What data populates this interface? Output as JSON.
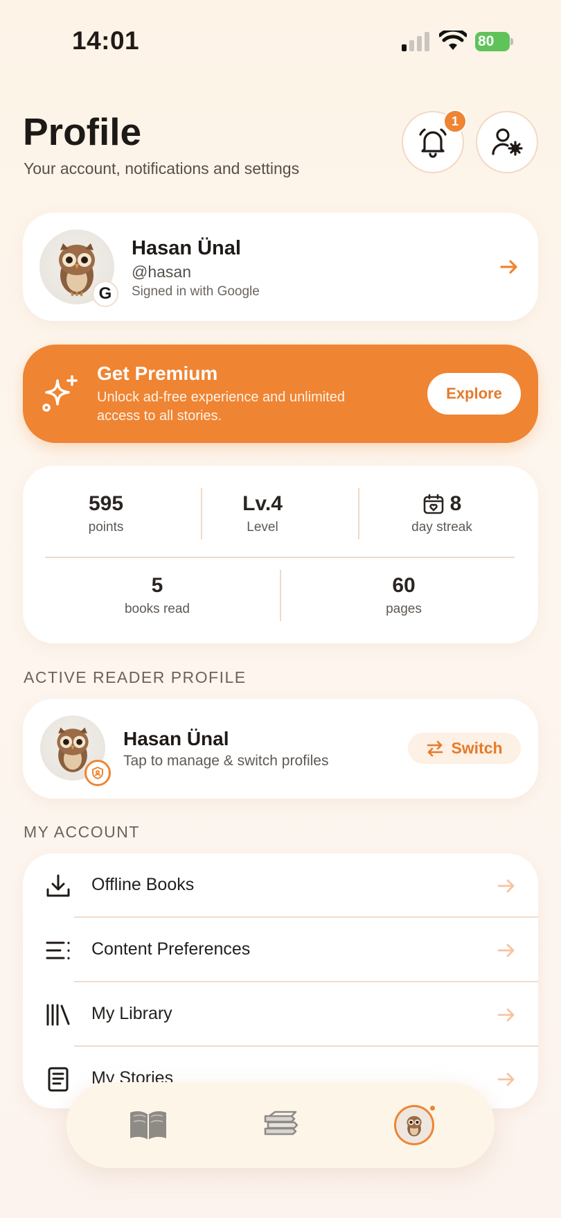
{
  "status_bar": {
    "time": "14:01",
    "battery": "80"
  },
  "header": {
    "title": "Profile",
    "subtitle": "Your account, notifications and settings",
    "notification_count": "1"
  },
  "user": {
    "name": "Hasan Ünal",
    "handle": "@hasan",
    "signin_method": "Signed in with Google",
    "provider_badge": "G"
  },
  "premium": {
    "title": "Get Premium",
    "description": "Unlock ad-free experience and unlimited access to all stories.",
    "button": "Explore"
  },
  "stats": {
    "points_value": "595",
    "points_label": "points",
    "level_value": "Lv.4",
    "level_label": "Level",
    "streak_value": "8",
    "streak_label": "day streak",
    "books_value": "5",
    "books_label": "books read",
    "pages_value": "60",
    "pages_label": "pages"
  },
  "reader_section": {
    "heading": "ACTIVE READER PROFILE",
    "name": "Hasan Ünal",
    "hint": "Tap to manage & switch profiles",
    "switch_label": "Switch"
  },
  "account_section": {
    "heading": "MY ACCOUNT",
    "items": [
      {
        "label": "Offline Books",
        "icon": "download-icon"
      },
      {
        "label": "Content Preferences",
        "icon": "list-icon"
      },
      {
        "label": "My Library",
        "icon": "library-icon"
      },
      {
        "label": "My Stories",
        "icon": "book-icon"
      }
    ]
  },
  "tab_bar": {
    "tabs": [
      {
        "name": "read",
        "icon": "open-book-icon"
      },
      {
        "name": "library",
        "icon": "books-stack-icon"
      },
      {
        "name": "profile",
        "icon": "owl-avatar-icon",
        "active": true
      }
    ]
  },
  "colors": {
    "accent": "#ef8433",
    "background": "#fdf4ec"
  }
}
